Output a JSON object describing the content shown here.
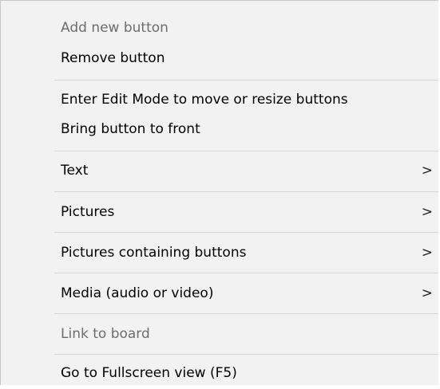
{
  "menu": {
    "items": [
      {
        "label": "Add new button",
        "enabled": false,
        "submenu": false
      },
      {
        "label": "Remove button",
        "enabled": true,
        "submenu": false
      },
      {
        "label": "Enter Edit Mode to move or resize buttons",
        "enabled": true,
        "submenu": false
      },
      {
        "label": "Bring button to front",
        "enabled": true,
        "submenu": false
      },
      {
        "label": "Text",
        "enabled": true,
        "submenu": true
      },
      {
        "label": "Pictures",
        "enabled": true,
        "submenu": true
      },
      {
        "label": "Pictures containing buttons",
        "enabled": true,
        "submenu": true
      },
      {
        "label": "Media (audio or video)",
        "enabled": true,
        "submenu": true
      },
      {
        "label": "Link to board",
        "enabled": false,
        "submenu": false
      },
      {
        "label": "Go to Fullscreen view (F5)",
        "enabled": true,
        "submenu": false
      }
    ],
    "submenu_arrow": ">"
  }
}
